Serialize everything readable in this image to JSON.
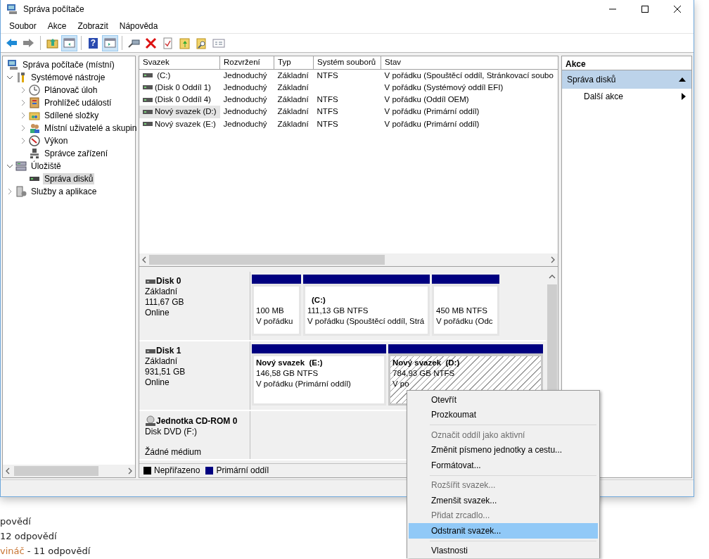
{
  "window": {
    "title": "Správa počítače"
  },
  "menu": [
    "Soubor",
    "Akce",
    "Zobrazit",
    "Nápověda"
  ],
  "toolbar": [
    {
      "kind": "back",
      "pressed": false
    },
    {
      "kind": "forward",
      "pressed": false
    },
    {
      "kind": "sep"
    },
    {
      "kind": "up",
      "pressed": false
    },
    {
      "kind": "tree",
      "pressed": true
    },
    {
      "kind": "sep"
    },
    {
      "kind": "help",
      "label": "?",
      "pressed": false
    },
    {
      "kind": "pane",
      "pressed": true
    },
    {
      "kind": "sep"
    },
    {
      "kind": "connect",
      "pressed": false
    },
    {
      "kind": "delete",
      "pressed": false
    },
    {
      "kind": "props",
      "pressed": false
    },
    {
      "kind": "folderup",
      "pressed": false
    },
    {
      "kind": "find",
      "pressed": false
    },
    {
      "kind": "list",
      "pressed": false
    }
  ],
  "tree": [
    {
      "label": "Správa počítače (místní)",
      "selected": false,
      "children": [
        {
          "label": "Systémové nástroje",
          "expanded": true,
          "selected": false,
          "children": [
            {
              "label": "Plánovač úloh",
              "expanded": false,
              "selected": false
            },
            {
              "label": "Prohlížeč událostí",
              "expanded": false,
              "selected": false
            },
            {
              "label": "Sdílené složky",
              "expanded": false,
              "selected": false
            },
            {
              "label": "Místní uživatelé a skupin",
              "expanded": false,
              "selected": false
            },
            {
              "label": "Výkon",
              "expanded": false,
              "selected": false
            },
            {
              "label": "Správce zařízení",
              "selected": false
            }
          ]
        },
        {
          "label": "Úložiště",
          "expanded": true,
          "selected": false,
          "children": [
            {
              "label": "Správa disků",
              "selected": true
            }
          ]
        },
        {
          "label": "Služby a aplikace",
          "expanded": false,
          "selected": false
        }
      ]
    }
  ],
  "table": {
    "columns": [
      "Svazek",
      "Rozvržení",
      "Typ",
      "Systém souborů",
      "Stav"
    ],
    "rows": [
      {
        "selected": false,
        "cells": [
          " (C:)",
          "Jednoduchý",
          "Základní",
          "NTFS",
          "V pořádku (Spouštěcí oddíl, Stránkovací soubo"
        ]
      },
      {
        "selected": false,
        "cells": [
          "(Disk 0 Oddíl 1)",
          "Jednoduchý",
          "Základní",
          "",
          "V pořádku (Systémový oddíl EFI)"
        ]
      },
      {
        "selected": false,
        "cells": [
          "(Disk 0 Oddíl 4)",
          "Jednoduchý",
          "Základní",
          "NTFS",
          "V pořádku (Oddíl OEM)"
        ]
      },
      {
        "selected": true,
        "cells": [
          "Nový svazek (D:)",
          "Jednoduchý",
          "Základní",
          "NTFS",
          "V pořádku (Primární oddíl)"
        ]
      },
      {
        "selected": false,
        "cells": [
          "Nový svazek (E:)",
          "Jednoduchý",
          "Základní",
          "NTFS",
          "V pořádku (Primární oddíl)"
        ]
      }
    ]
  },
  "disks": [
    {
      "kind": "disk",
      "name": "Disk 0",
      "type": "Základní",
      "size": "111,67 GB",
      "status": "Online",
      "partitions": [
        {
          "size": "100 MB",
          "status": "V pořádku",
          "selected": false
        },
        {
          "title": "(C:)",
          "size": "111,13 GB NTFS",
          "status": "V pořádku (Spouštěcí oddíl, Strá",
          "selected": false
        },
        {
          "size": "450 MB NTFS",
          "status": "V pořádku (Odc",
          "selected": false
        }
      ]
    },
    {
      "kind": "disk",
      "name": "Disk 1",
      "type": "Základní",
      "size": "931,51 GB",
      "status": "Online",
      "partitions": [
        {
          "title": "Nový svazek  (E:)",
          "size": "146,58 GB NTFS",
          "status": "V pořádku (Primární oddíl)",
          "selected": false
        },
        {
          "title": "Nový svazek  (D:)",
          "size": "784,93 GB NTFS",
          "status": "V po",
          "selected": true
        }
      ]
    },
    {
      "kind": "cdrom",
      "name": "Jednotka CD-ROM 0",
      "type": "Disk DVD (F:)",
      "status": "Žádné médium"
    }
  ],
  "legend": [
    {
      "label": "Nepřiřazeno",
      "color": "#000000"
    },
    {
      "label": "Primární oddíl",
      "color": "#000080"
    }
  ],
  "actions": {
    "title": "Akce",
    "section": "Správa disků",
    "expanded": true,
    "items": [
      "Další akce"
    ]
  },
  "context_menu": [
    {
      "kind": "item",
      "label": "Otevřít",
      "disabled": false,
      "selected": false
    },
    {
      "kind": "item",
      "label": "Prozkoumat",
      "disabled": false,
      "selected": false
    },
    {
      "kind": "sep"
    },
    {
      "kind": "item",
      "label": "Označit oddíl jako aktivní",
      "disabled": true,
      "selected": false
    },
    {
      "kind": "item",
      "label": "Změnit písmeno jednotky a cestu...",
      "disabled": false,
      "selected": false
    },
    {
      "kind": "item",
      "label": "Formátovat...",
      "disabled": false,
      "selected": false
    },
    {
      "kind": "sep"
    },
    {
      "kind": "item",
      "label": "Rozšířit svazek...",
      "disabled": true,
      "selected": false
    },
    {
      "kind": "item",
      "label": "Zmenšit svazek...",
      "disabled": false,
      "selected": false
    },
    {
      "kind": "item",
      "label": "Přidat zrcadlo...",
      "disabled": true,
      "selected": false
    },
    {
      "kind": "item",
      "label": "Odstranit svazek...",
      "disabled": false,
      "selected": true
    },
    {
      "kind": "sep"
    },
    {
      "kind": "item",
      "label": "Vlastnosti",
      "disabled": false,
      "selected": false
    }
  ],
  "background_page": [
    {
      "text": "povědí"
    },
    {
      "text": "12 odpovědí"
    },
    {
      "link": "vináč",
      "text": " - 11 odpovědí"
    }
  ]
}
